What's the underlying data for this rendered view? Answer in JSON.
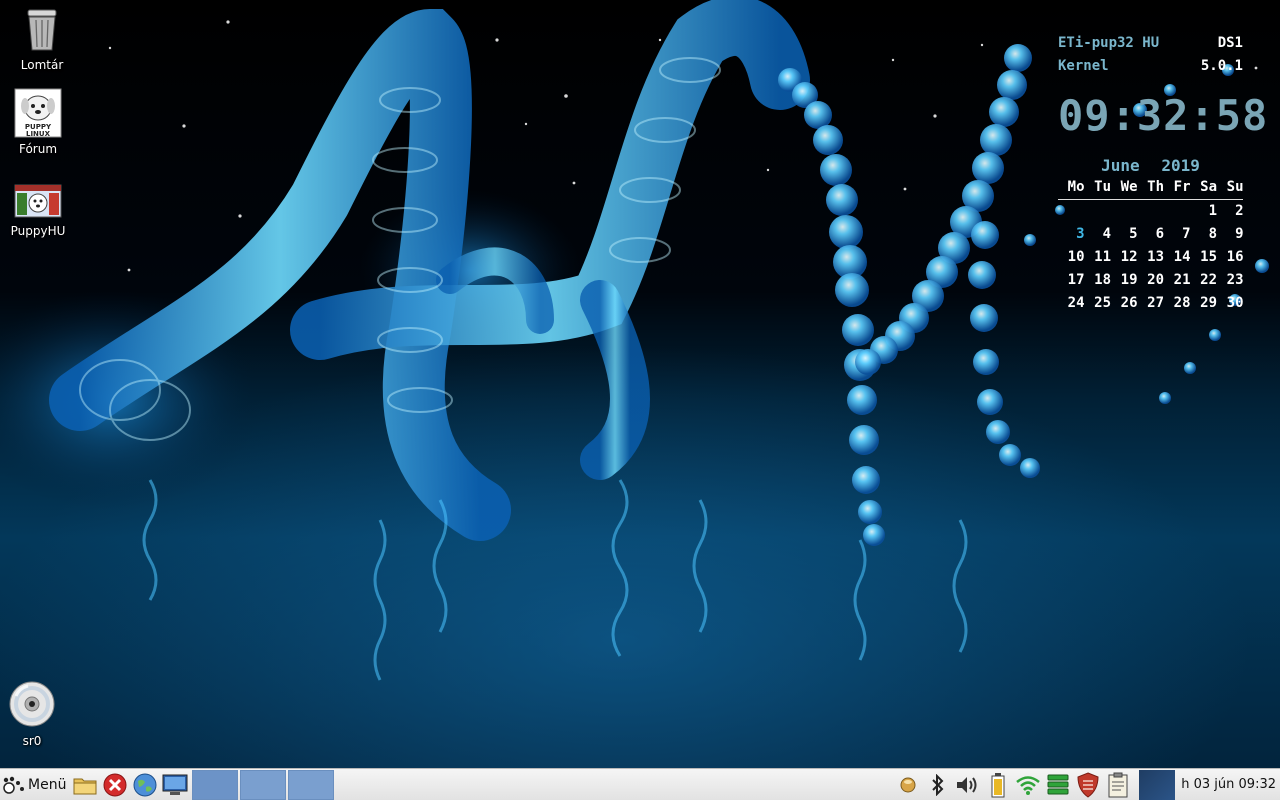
{
  "desktop": {
    "icons": [
      {
        "label": "Lomtár",
        "icon": "trash-icon"
      },
      {
        "label": "Fórum",
        "icon": "puppy-forum-icon"
      },
      {
        "label": "PuppyHU",
        "icon": "puppyhu-icon"
      },
      {
        "label": "sr0",
        "icon": "cdrom-icon"
      }
    ]
  },
  "conky": {
    "distro_label": "ETi-pup32 HU",
    "distro_value": "DS1",
    "kernel_label": "Kernel",
    "kernel_value": "5.0.1",
    "clock": "09:32:58",
    "calendar": {
      "month": "June",
      "year": "2019",
      "weekdays": [
        "Mo",
        "Tu",
        "We",
        "Th",
        "Fr",
        "Sa",
        "Su"
      ],
      "weeks": [
        [
          "",
          "",
          "",
          "",
          "",
          "1",
          "2"
        ],
        [
          "3",
          "4",
          "5",
          "6",
          "7",
          "8",
          "9"
        ],
        [
          "10",
          "11",
          "12",
          "13",
          "14",
          "15",
          "16"
        ],
        [
          "17",
          "18",
          "19",
          "20",
          "21",
          "22",
          "23"
        ],
        [
          "24",
          "25",
          "26",
          "27",
          "28",
          "29",
          "30"
        ]
      ],
      "today": "3"
    }
  },
  "taskbar": {
    "menu_label": "Menü",
    "clock": "h 03 jún 09:32",
    "colors": {
      "pager": "#7a9fcf",
      "today": "#3fb8e6"
    }
  }
}
